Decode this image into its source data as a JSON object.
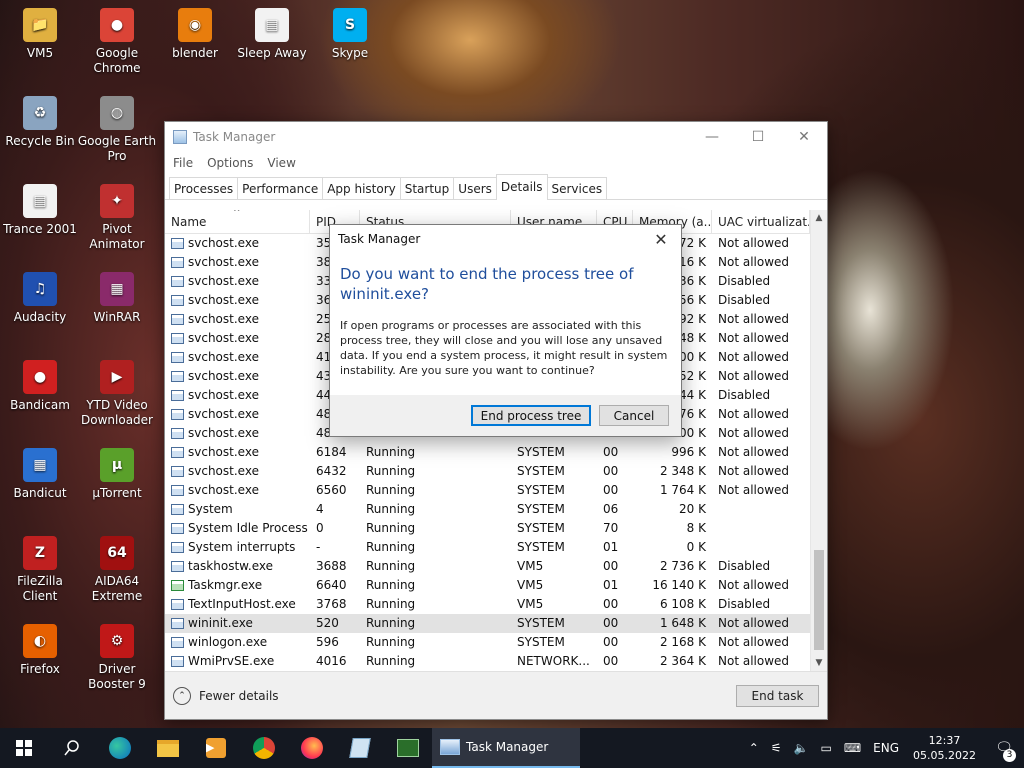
{
  "desktop": {
    "icons": [
      {
        "label": "VM5",
        "glyph": "📁",
        "color": "#e0b040"
      },
      {
        "label": "Google Chrome",
        "glyph": "●",
        "color": "#db4437"
      },
      {
        "label": "blender",
        "glyph": "◉",
        "color": "#e87d0d"
      },
      {
        "label": "Sleep Away",
        "glyph": "▤",
        "color": "#f2f2f2"
      },
      {
        "label": "Skype",
        "glyph": "S",
        "color": "#00aff0"
      },
      {
        "label": "Recycle Bin",
        "glyph": "♻",
        "color": "#8aa4c0"
      },
      {
        "label": "Google Earth Pro",
        "glyph": "◍",
        "color": "#8c8c8c"
      },
      {
        "label": "Trance 2001",
        "glyph": "▤",
        "color": "#f2f2f2"
      },
      {
        "label": "Pivot Animator",
        "glyph": "✦",
        "color": "#c03030"
      },
      {
        "label": "Audacity",
        "glyph": "♫",
        "color": "#2050b0"
      },
      {
        "label": "WinRAR",
        "glyph": "▦",
        "color": "#8a2a6a"
      },
      {
        "label": "Bandicam",
        "glyph": "●",
        "color": "#d02020"
      },
      {
        "label": "YTD Video Downloader",
        "glyph": "▶",
        "color": "#b02020"
      },
      {
        "label": "Bandicut",
        "glyph": "▦",
        "color": "#2a70d0"
      },
      {
        "label": "µTorrent",
        "glyph": "µ",
        "color": "#5aa02a"
      },
      {
        "label": "FileZilla Client",
        "glyph": "Z",
        "color": "#c02020"
      },
      {
        "label": "AIDA64 Extreme",
        "glyph": "64",
        "color": "#a01010"
      },
      {
        "label": "Firefox",
        "glyph": "◐",
        "color": "#e66000"
      },
      {
        "label": "Driver Booster 9",
        "glyph": "⚙",
        "color": "#c01818"
      }
    ]
  },
  "taskmgr": {
    "title": "Task Manager",
    "menu": [
      "File",
      "Options",
      "View"
    ],
    "tabs": [
      "Processes",
      "Performance",
      "App history",
      "Startup",
      "Users",
      "Details",
      "Services"
    ],
    "active_tab": "Details",
    "columns": [
      "Name",
      "PID",
      "Status",
      "User name",
      "CPU",
      "Memory (a...",
      "UAC virtualizat..."
    ],
    "rows": [
      [
        "svchost.exe",
        "35",
        "",
        "",
        "",
        "72 K",
        "Not allowed"
      ],
      [
        "svchost.exe",
        "38",
        "",
        "",
        "",
        "16 K",
        "Not allowed"
      ],
      [
        "svchost.exe",
        "33",
        "",
        "",
        "",
        "36 K",
        "Disabled"
      ],
      [
        "svchost.exe",
        "36",
        "",
        "",
        "",
        "56 K",
        "Disabled"
      ],
      [
        "svchost.exe",
        "25",
        "",
        "",
        "",
        "92 K",
        "Not allowed"
      ],
      [
        "svchost.exe",
        "28",
        "",
        "",
        "",
        "48 K",
        "Not allowed"
      ],
      [
        "svchost.exe",
        "41",
        "",
        "",
        "",
        "00 K",
        "Not allowed"
      ],
      [
        "svchost.exe",
        "43",
        "",
        "",
        "",
        "52 K",
        "Not allowed"
      ],
      [
        "svchost.exe",
        "44",
        "",
        "",
        "",
        "44 K",
        "Disabled"
      ],
      [
        "svchost.exe",
        "48",
        "",
        "",
        "",
        "76 K",
        "Not allowed"
      ],
      [
        "svchost.exe",
        "48",
        "",
        "",
        "",
        "00 K",
        "Not allowed"
      ],
      [
        "svchost.exe",
        "6184",
        "Running",
        "SYSTEM",
        "00",
        "996 K",
        "Not allowed"
      ],
      [
        "svchost.exe",
        "6432",
        "Running",
        "SYSTEM",
        "00",
        "2 348 K",
        "Not allowed"
      ],
      [
        "svchost.exe",
        "6560",
        "Running",
        "SYSTEM",
        "00",
        "1 764 K",
        "Not allowed"
      ],
      [
        "System",
        "4",
        "Running",
        "SYSTEM",
        "06",
        "20 K",
        ""
      ],
      [
        "System Idle Process",
        "0",
        "Running",
        "SYSTEM",
        "70",
        "8 K",
        ""
      ],
      [
        "System interrupts",
        "-",
        "Running",
        "SYSTEM",
        "01",
        "0 K",
        ""
      ],
      [
        "taskhostw.exe",
        "3688",
        "Running",
        "VM5",
        "00",
        "2 736 K",
        "Disabled"
      ],
      [
        "Taskmgr.exe",
        "6640",
        "Running",
        "VM5",
        "01",
        "16 140 K",
        "Not allowed"
      ],
      [
        "TextInputHost.exe",
        "3768",
        "Running",
        "VM5",
        "00",
        "6 108 K",
        "Disabled"
      ],
      [
        "wininit.exe",
        "520",
        "Running",
        "SYSTEM",
        "00",
        "1 648 K",
        "Not allowed"
      ],
      [
        "winlogon.exe",
        "596",
        "Running",
        "SYSTEM",
        "00",
        "2 168 K",
        "Not allowed"
      ],
      [
        "WmiPrvSE.exe",
        "4016",
        "Running",
        "NETWORK...",
        "00",
        "2 364 K",
        "Not allowed"
      ]
    ],
    "selected_row": 20,
    "fewer_details": "Fewer details",
    "end_task": "End task"
  },
  "dialog": {
    "title": "Task Manager",
    "heading": "Do you want to end the process tree of wininit.exe?",
    "body": "If open programs or processes are associated with this process tree, they will close and you will lose any unsaved data. If you end a system process, it might result in system instability. Are you sure you want to continue?",
    "confirm": "End process tree",
    "cancel": "Cancel"
  },
  "taskbar": {
    "active_app": "Task Manager",
    "language": "ENG",
    "time": "12:37",
    "date": "05.05.2022",
    "notifications": "3"
  }
}
